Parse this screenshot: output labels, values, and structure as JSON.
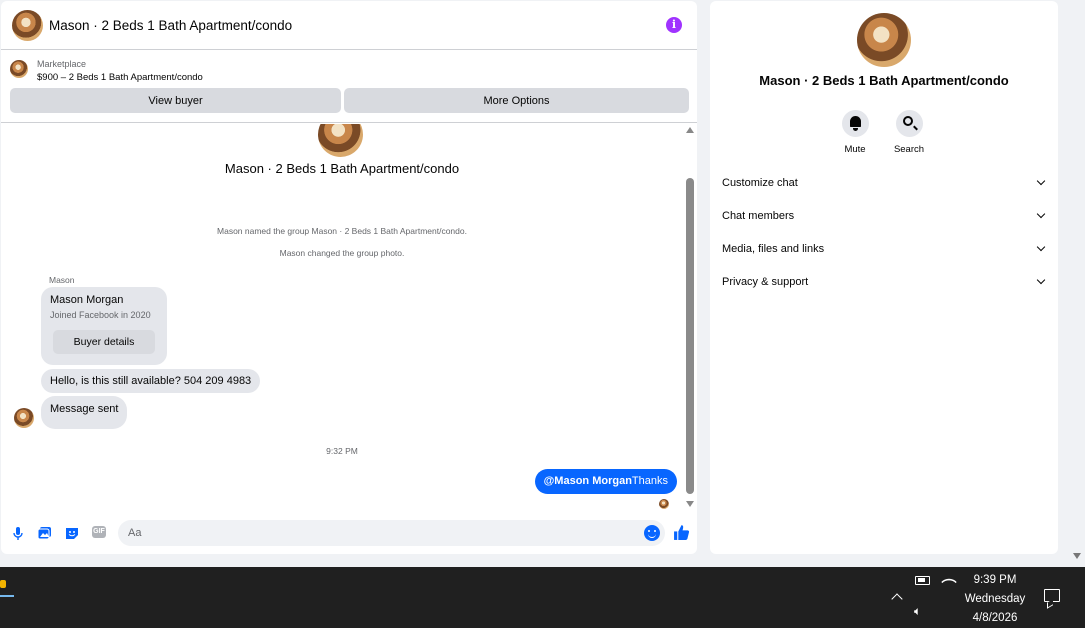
{
  "header": {
    "title": "Mason · 2 Beds 1 Bath Apartment/condo",
    "info_icon": "info-icon"
  },
  "marketplace": {
    "label": "Marketplace",
    "listing": "$900 – 2 Beds 1 Bath Apartment/condo",
    "view_buyer_label": "View buyer",
    "more_options_label": "More Options"
  },
  "thread": {
    "group_name": "Mason · 2 Beds 1 Bath Apartment/condo",
    "system_messages": [
      "Mason named the group Mason · 2 Beds 1 Bath Apartment/condo.",
      "Mason changed the group photo."
    ],
    "sender_name": "Mason",
    "buyer_card": {
      "name": "Mason Morgan",
      "subtitle": "Joined Facebook in 2020",
      "button_label": "Buyer details"
    },
    "incoming": [
      "Hello, is this still available? 504 209 4983",
      "Message sent"
    ],
    "timestamp": "9:32 PM",
    "outgoing": {
      "mention": "@Mason Morgan",
      "text": "Thanks"
    }
  },
  "composer": {
    "placeholder": "Aa",
    "icons": [
      "microphone-icon",
      "photo-icon",
      "sticker-icon",
      "gif-icon",
      "emoji-icon",
      "like-icon"
    ],
    "gif_label": "GIF",
    "accent_color": "#0866ff"
  },
  "details": {
    "title": "Mason · 2 Beds 1 Bath Apartment/condo",
    "actions": [
      {
        "label": "Mute",
        "icon": "bell-icon"
      },
      {
        "label": "Search",
        "icon": "search-icon"
      }
    ],
    "sections": [
      "Customize chat",
      "Chat members",
      "Media, files and links",
      "Privacy & support"
    ]
  },
  "taskbar": {
    "time": "9:39 PM",
    "day": "Wednesday",
    "date": "4/8/2026"
  }
}
